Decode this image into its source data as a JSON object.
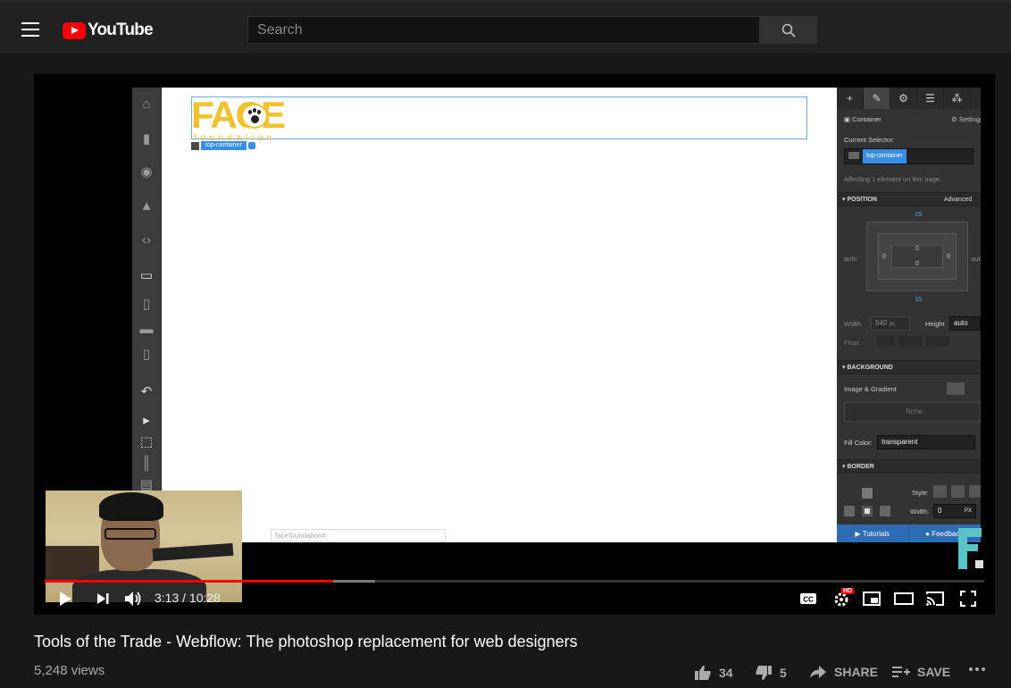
{
  "header": {
    "logo_text": "YouTube",
    "search_placeholder": "Search"
  },
  "webflow": {
    "logo_text": "FACE",
    "logo_sub": "foundation",
    "selector_tag": "top-container",
    "canvas_url": "facefoundation#",
    "panel": {
      "element_type": "Container",
      "settings_label": "Settings",
      "current_selector_label": "Current Selector:",
      "selector_value": "top-container",
      "affecting_text": "Affecting 1 element on this page.",
      "position_section": "POSITION",
      "advanced_label": "Advanced",
      "box_values": {
        "top": "15",
        "bottom": "15",
        "left": "auto",
        "right": "auto",
        "inner_top": "0",
        "inner_bottom": "0",
        "inner_left": "0",
        "inner_right": "0"
      },
      "width_label": "Width",
      "width_value": "940",
      "width_unit": "px",
      "height_label": "Height",
      "height_value": "auto",
      "float_label": "Float",
      "background_section": "BACKGROUND",
      "image_gradient_label": "Image & Gradient",
      "none_label": "None",
      "fill_color_label": "Fill Color:",
      "fill_color_value": "transparent",
      "border_section": "BORDER",
      "style_label": "Style:",
      "border_width_label": "Width:",
      "border_width_value": "0",
      "border_width_unit": "PX",
      "tutorials_label": "Tutorials",
      "feedback_label": "Feedback"
    }
  },
  "player": {
    "current_time": "3:13",
    "duration": "10:28",
    "time_display": "3:13 / 10:28",
    "played_fraction": 0.307,
    "loaded_fraction": 0.352,
    "hd_badge": "HD"
  },
  "video": {
    "title": "Tools of the Trade - Webflow: The photoshop replacement for web designers",
    "views": "5,248 views",
    "likes": "34",
    "dislikes": "5",
    "share_label": "SHARE",
    "save_label": "SAVE",
    "more_label": "..."
  },
  "colors": {
    "brand_red": "#ff0000",
    "page_bg": "#181818",
    "topbar_bg": "#212121",
    "webflow_blue": "#3a8ee6",
    "face_yellow": "#f2c12e"
  }
}
